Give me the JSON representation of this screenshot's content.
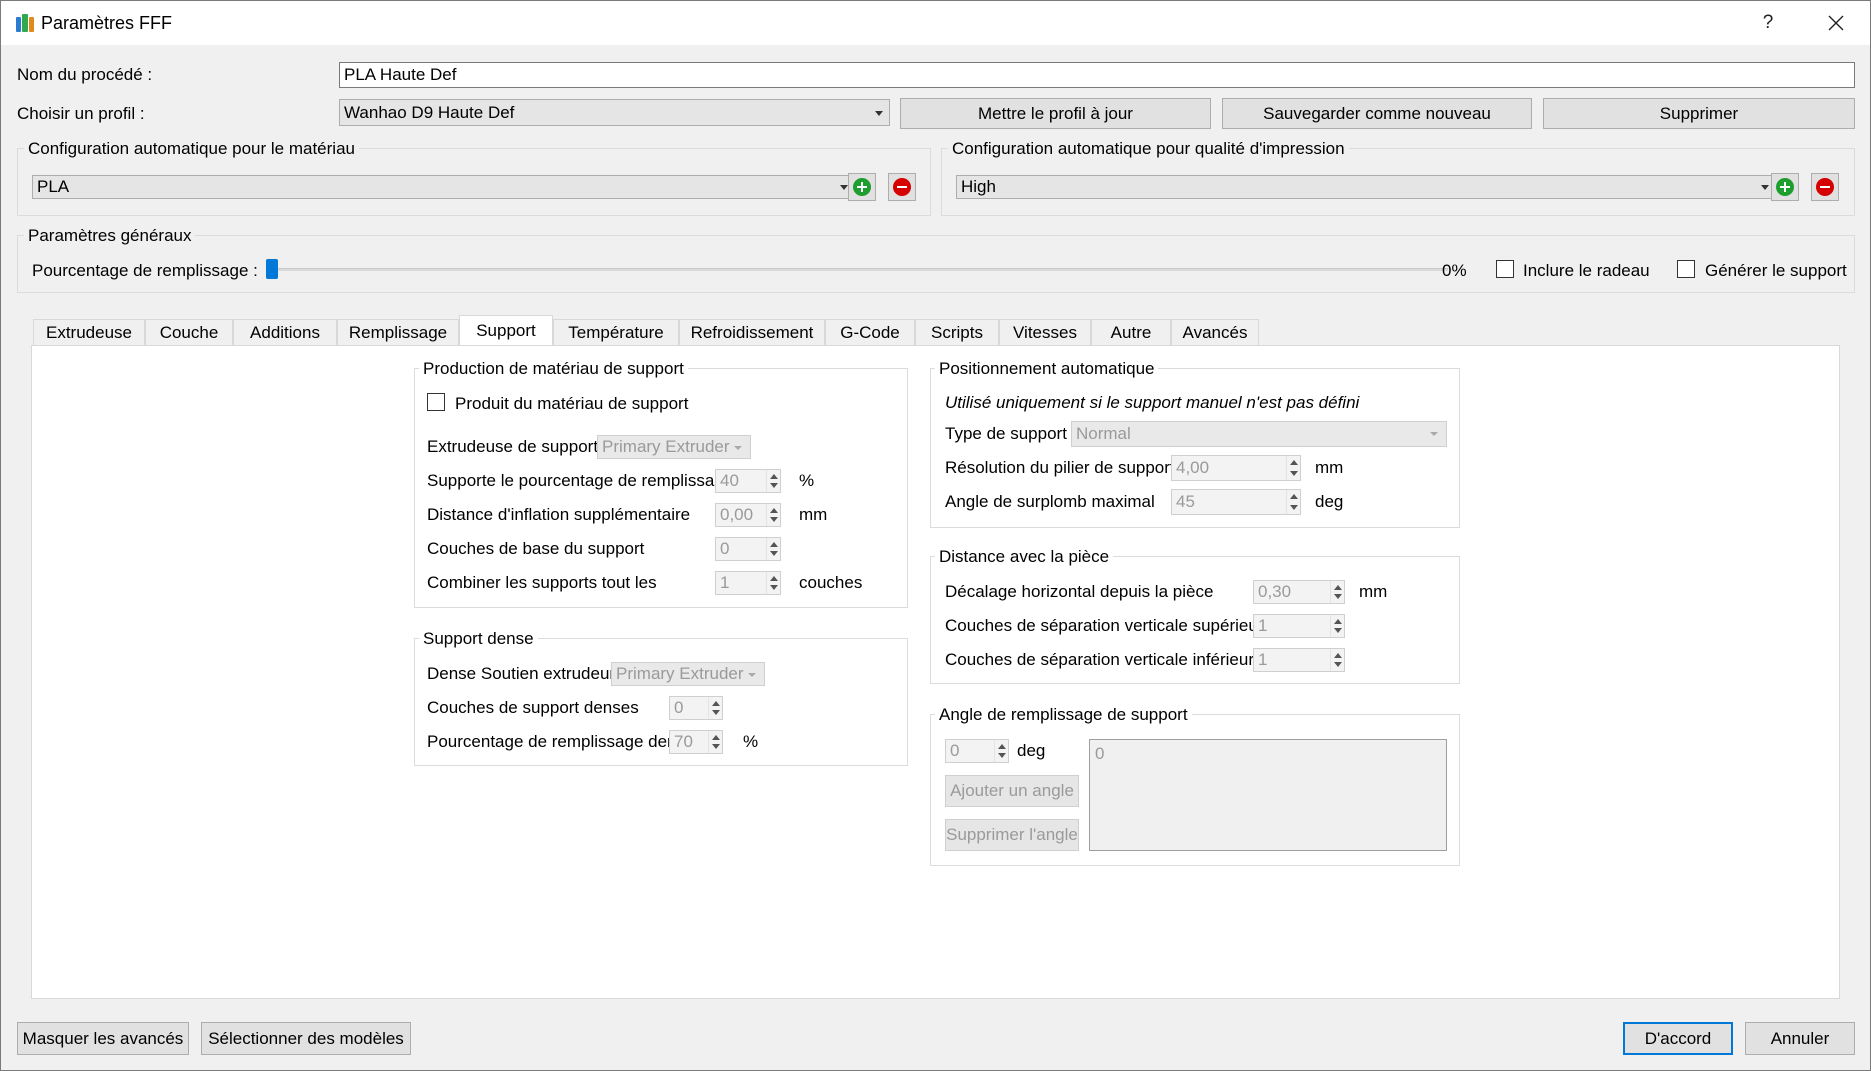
{
  "window": {
    "title": "Paramètres FFF",
    "help": "?"
  },
  "process": {
    "label": "Nom du procédé :",
    "value": "PLA Haute Def"
  },
  "profile": {
    "label": "Choisir un profil :",
    "value": "Wanhao D9 Haute Def",
    "update_button": "Mettre le profil à jour",
    "save_new_button": "Sauvegarder comme nouveau",
    "delete_button": "Supprimer"
  },
  "auto_material": {
    "title": "Configuration automatique pour le matériau",
    "value": "PLA"
  },
  "auto_quality": {
    "title": "Configuration automatique pour qualité d'impression",
    "value": "High"
  },
  "general": {
    "title": "Paramètres généraux",
    "infill_label": "Pourcentage de remplissage :",
    "infill_value": "0%",
    "infill_fraction": 0,
    "raft_label": "Inclure le radeau",
    "raft_checked": false,
    "support_label": "Générer le support",
    "support_checked": false
  },
  "tabs": [
    {
      "label": "Extrudeuse"
    },
    {
      "label": "Couche"
    },
    {
      "label": "Additions"
    },
    {
      "label": "Remplissage"
    },
    {
      "label": "Support",
      "active": true
    },
    {
      "label": "Température"
    },
    {
      "label": "Refroidissement"
    },
    {
      "label": "G-Code"
    },
    {
      "label": "Scripts"
    },
    {
      "label": "Vitesses"
    },
    {
      "label": "Autre"
    },
    {
      "label": "Avancés"
    }
  ],
  "support_production": {
    "title": "Production de matériau de support",
    "generate_label": "Produit du matériau de support",
    "generate_checked": false,
    "extruder_label": "Extrudeuse de support",
    "extruder_value": "Primary Extruder",
    "infill_label": "Supporte le pourcentage de remplissage",
    "infill_value": "40",
    "infill_unit": "%",
    "inflation_label": "Distance d'inflation supplémentaire",
    "inflation_value": "0,00",
    "inflation_unit": "mm",
    "base_layers_label": "Couches de base du support",
    "base_layers_value": "0",
    "combine_label": "Combiner les supports tout les",
    "combine_value": "1",
    "combine_unit": "couches"
  },
  "dense_support": {
    "title": "Support dense",
    "extruder_label": "Dense Soutien extrudeur",
    "extruder_value": "Primary Extruder",
    "layers_label": "Couches de support denses",
    "layers_value": "0",
    "infill_label": "Pourcentage de remplissage dense",
    "infill_value": "70",
    "infill_unit": "%"
  },
  "auto_placement": {
    "title": "Positionnement automatique",
    "note": "Utilisé uniquement si le support manuel n'est pas défini",
    "type_label": "Type de support",
    "type_value": "Normal",
    "pillar_label": "Résolution du pilier de support",
    "pillar_value": "4,00",
    "pillar_unit": "mm",
    "overhang_label": "Angle de surplomb maximal",
    "overhang_value": "45",
    "overhang_unit": "deg"
  },
  "part_distance": {
    "title": "Distance avec la pièce",
    "horizontal_label": "Décalage horizontal depuis la pièce",
    "horizontal_value": "0,30",
    "horizontal_unit": "mm",
    "upper_label": "Couches de séparation verticale supérieure",
    "upper_value": "1",
    "lower_label": "Couches de séparation verticale inférieure",
    "lower_value": "1"
  },
  "infill_angle": {
    "title": "Angle de remplissage de support",
    "angle_value": "0",
    "angle_unit": "deg",
    "add_button": "Ajouter un angle",
    "remove_button": "Supprimer l'angle",
    "list_items": [
      "0"
    ]
  },
  "footer": {
    "hide_advanced": "Masquer les avancés",
    "select_models": "Sélectionner des modèles",
    "ok": "D'accord",
    "cancel": "Annuler"
  },
  "colors": {
    "accent": "#0078d7",
    "add": "#1e9e2e",
    "remove": "#d50000"
  }
}
